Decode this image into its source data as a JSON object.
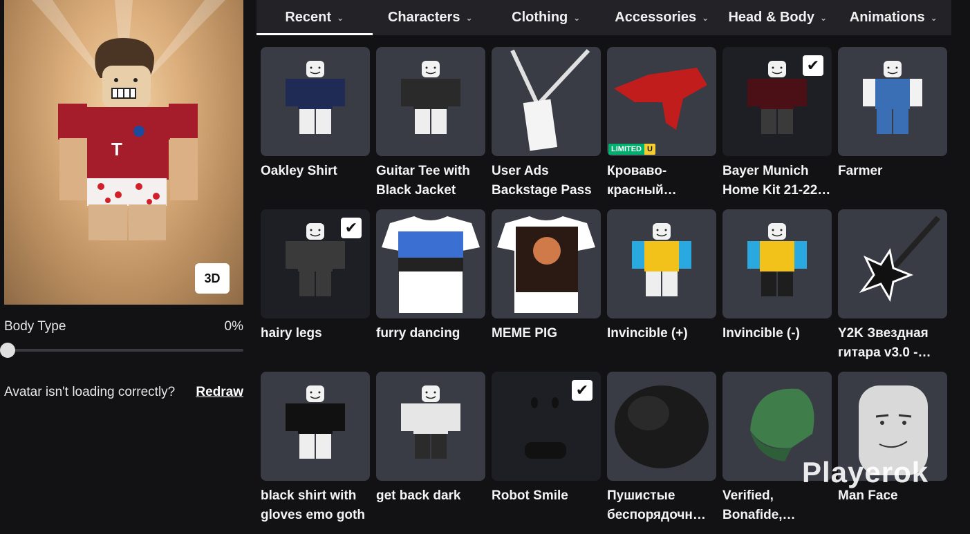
{
  "tabs": [
    {
      "label": "Recent",
      "active": true
    },
    {
      "label": "Characters",
      "active": false
    },
    {
      "label": "Clothing",
      "active": false
    },
    {
      "label": "Accessories",
      "active": false
    },
    {
      "label": "Head & Body",
      "active": false
    },
    {
      "label": "Animations",
      "active": false
    }
  ],
  "avatar": {
    "view_button": "3D",
    "body_type_label": "Body Type",
    "body_type_value": "0%",
    "body_type_fraction": 0,
    "loading_text": "Avatar isn't loading correctly?",
    "redraw_label": "Redraw"
  },
  "items": [
    {
      "name": "Oakley Shirt",
      "icon": "avatar-shirt-navy-icon",
      "selected": false,
      "badge": ""
    },
    {
      "name": "Guitar Tee with Black Jacket",
      "icon": "avatar-jacket-icon",
      "selected": false,
      "badge": ""
    },
    {
      "name": "User Ads Backstage Pass",
      "icon": "lanyard-pass-icon",
      "selected": false,
      "badge": ""
    },
    {
      "name": "Кроваво-красный…",
      "icon": "red-creature-icon",
      "selected": false,
      "badge": "LIMITED",
      "badge2": "U"
    },
    {
      "name": "Bayer Munich Home Kit 21-22…",
      "icon": "avatar-shirt-red-icon",
      "selected": true,
      "badge": ""
    },
    {
      "name": "Farmer",
      "icon": "avatar-overalls-icon",
      "selected": false,
      "badge": ""
    },
    {
      "name": "hairy legs",
      "icon": "avatar-pants-grey-icon",
      "selected": true,
      "badge": ""
    },
    {
      "name": "furry dancing",
      "icon": "tshirt-car-icon",
      "selected": false,
      "badge": ""
    },
    {
      "name": "MEME PIG",
      "icon": "tshirt-pig-icon",
      "selected": false,
      "badge": ""
    },
    {
      "name": "Invincible (+)",
      "icon": "avatar-yellow-blue-icon",
      "selected": false,
      "badge": ""
    },
    {
      "name": "Invincible (-)",
      "icon": "avatar-yellow-black-icon",
      "selected": false,
      "badge": ""
    },
    {
      "name": "Y2K Звездная гитара v3.0 -…",
      "icon": "star-guitar-icon",
      "selected": false,
      "badge": ""
    },
    {
      "name": "black shirt with gloves emo goth",
      "icon": "avatar-black-shirt-icon",
      "selected": false,
      "badge": ""
    },
    {
      "name": "get back dark",
      "icon": "avatar-dark-pants-icon",
      "selected": false,
      "badge": ""
    },
    {
      "name": "Robot Smile",
      "icon": "robot-face-icon",
      "selected": true,
      "badge": ""
    },
    {
      "name": "Пушистые беспорядочны…",
      "icon": "fluffy-hair-icon",
      "selected": false,
      "badge": ""
    },
    {
      "name": "Verified, Bonafide,…",
      "icon": "green-cap-icon",
      "selected": false,
      "badge": ""
    },
    {
      "name": "Man Face",
      "icon": "man-face-icon",
      "selected": false,
      "badge": ""
    }
  ],
  "watermark": "Playerok",
  "colors": {
    "background": "#121215",
    "tab_bar": "#232327",
    "tile": "#393b45",
    "limited_green": "#00b06f",
    "limited_yellow": "#f5cd30"
  }
}
